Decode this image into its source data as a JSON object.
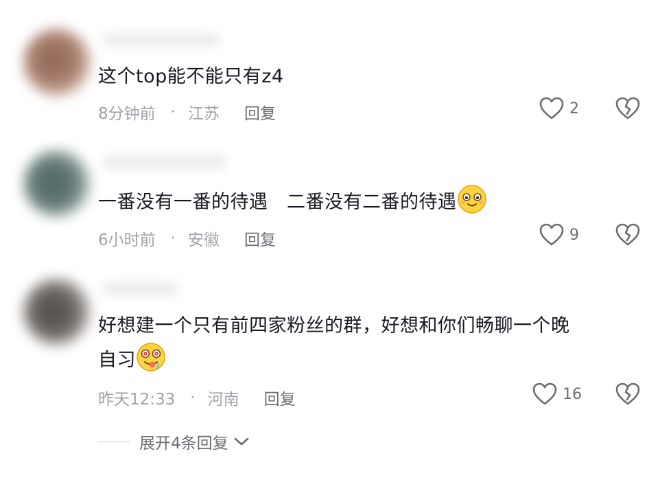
{
  "comments": [
    {
      "text": "这个top能不能只有z4",
      "time": "8分钟前",
      "location": "江苏",
      "reply_label": "回复",
      "likes": "2"
    },
    {
      "text": "一番没有一番的待遇　二番没有二番的待遇",
      "emoji": "smiling-face-emoji",
      "time": "6小时前",
      "location": "安徽",
      "reply_label": "回复",
      "likes": "9"
    },
    {
      "text_line1": "好想建一个只有前四家粉丝的群，好想和你们畅聊一个晚",
      "text_line2": "自习",
      "emoji": "drooling-face-emoji",
      "time": "昨天12:33",
      "location": "河南",
      "reply_label": "回复",
      "likes": "16"
    }
  ],
  "separator": "·",
  "expand_replies_label": "展开4条回复",
  "colors": {
    "text_primary": "#161823",
    "text_meta": "#a1a2a7",
    "text_action": "#6b6c72",
    "icon": "#6b6c72"
  },
  "icons": [
    "heart-outline-icon",
    "broken-heart-icon",
    "chevron-down-icon"
  ]
}
